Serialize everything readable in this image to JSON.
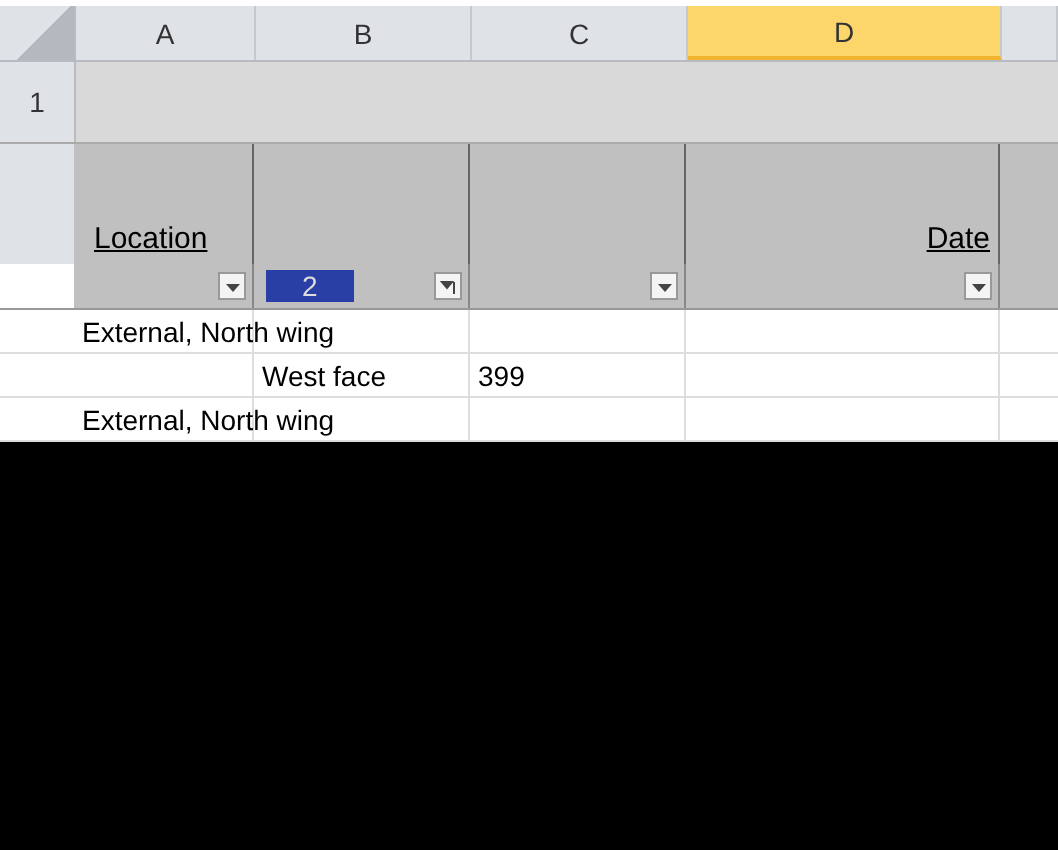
{
  "columns": [
    {
      "letter": "A",
      "selected": false
    },
    {
      "letter": "B",
      "selected": false
    },
    {
      "letter": "C",
      "selected": false
    },
    {
      "letter": "D",
      "selected": true
    }
  ],
  "row_numbers": [
    "1"
  ],
  "header": {
    "A": "Location",
    "D": "Date"
  },
  "filters": [
    {
      "kind": "dropdown"
    },
    {
      "kind": "sort",
      "value": "2"
    },
    {
      "kind": "dropdown"
    },
    {
      "kind": "dropdown"
    }
  ],
  "rows": [
    {
      "A": "External, North wing"
    },
    {
      "B": "West face",
      "C": "399"
    },
    {
      "A": "External, North wing"
    }
  ]
}
